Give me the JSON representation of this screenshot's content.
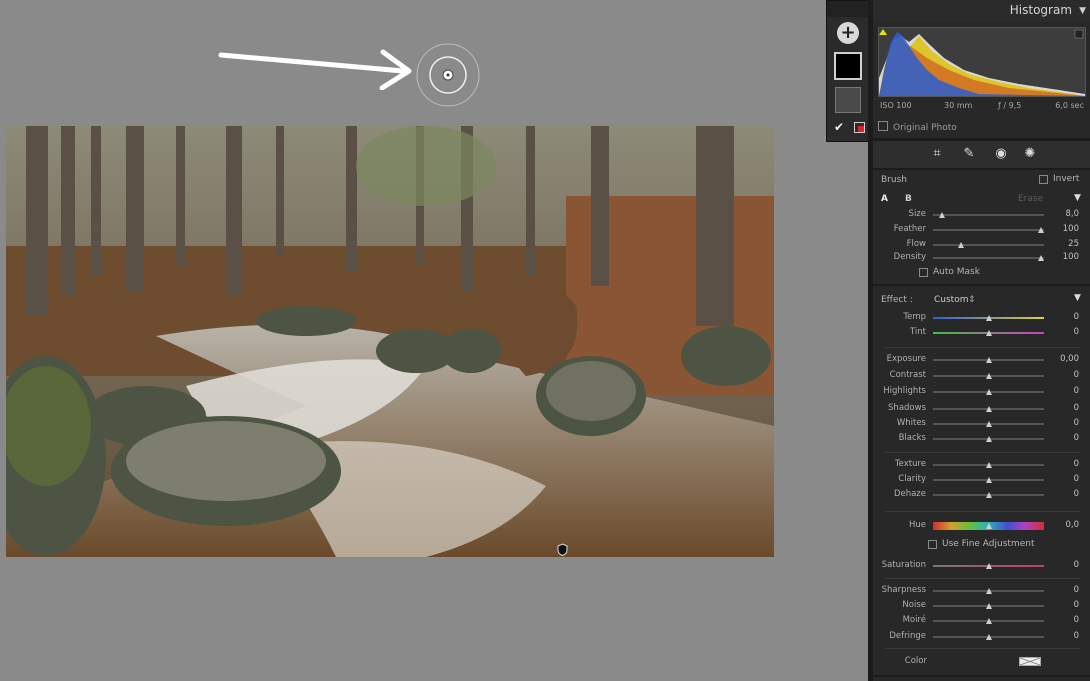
{
  "histogram": {
    "title": "Histogram",
    "iso": "ISO 100",
    "focal": "30 mm",
    "aperture": "ƒ / 9,5",
    "shutter": "6,0 sec",
    "original_photo_label": "Original Photo"
  },
  "brush": {
    "title": "Brush",
    "invert_label": "Invert",
    "tab_a": "A",
    "tab_b": "B",
    "erase_label": "Erase",
    "sliders": [
      {
        "label": "Size",
        "value": "8,0",
        "pos": 0.08
      },
      {
        "label": "Feather",
        "value": "100",
        "pos": 0.97
      },
      {
        "label": "Flow",
        "value": "25",
        "pos": 0.25
      },
      {
        "label": "Density",
        "value": "100",
        "pos": 0.97
      }
    ],
    "auto_mask_label": "Auto Mask"
  },
  "effect": {
    "label": "Effect :",
    "preset": "Custom",
    "temp_tint": [
      {
        "label": "Temp",
        "value": "0"
      },
      {
        "label": "Tint",
        "value": "0"
      }
    ],
    "tone": [
      {
        "label": "Exposure",
        "value": "0,00"
      },
      {
        "label": "Contrast",
        "value": "0"
      },
      {
        "label": "Highlights",
        "value": "0"
      },
      {
        "label": "Shadows",
        "value": "0"
      },
      {
        "label": "Whites",
        "value": "0"
      },
      {
        "label": "Blacks",
        "value": "0"
      }
    ],
    "presence": [
      {
        "label": "Texture",
        "value": "0"
      },
      {
        "label": "Clarity",
        "value": "0"
      },
      {
        "label": "Dehaze",
        "value": "0"
      }
    ],
    "hue": {
      "label": "Hue",
      "value": "0,0"
    },
    "fine_adjust_label": "Use Fine Adjustment",
    "saturation": {
      "label": "Saturation",
      "value": "0"
    },
    "detail": [
      {
        "label": "Sharpness",
        "value": "0"
      },
      {
        "label": "Noise",
        "value": "0"
      },
      {
        "label": "Moiré",
        "value": "0"
      },
      {
        "label": "Defringe",
        "value": "0"
      }
    ],
    "color_label": "Color"
  },
  "tools": [
    "crop-icon",
    "healing-icon",
    "redeye-icon",
    "mask-icon"
  ],
  "colors": {
    "panel_bg": "#282828",
    "canvas_bg": "#8a8a8a",
    "accent": "#f0d000"
  }
}
